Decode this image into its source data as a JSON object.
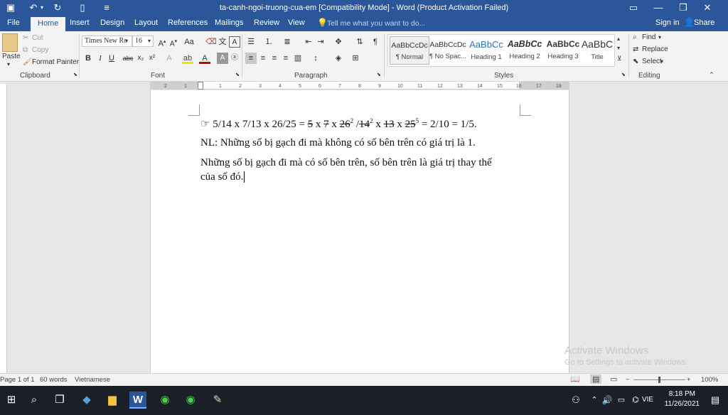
{
  "window": {
    "title": "ta-canh-ngoi-truong-cua-em [Compatibility Mode] - Word (Product Activation Failed)",
    "sign_in": "Sign in",
    "share": "Share"
  },
  "tabs": [
    "File",
    "Home",
    "Insert",
    "Design",
    "Layout",
    "References",
    "Mailings",
    "Review",
    "View"
  ],
  "tell_me": "Tell me what you want to do...",
  "clipboard": {
    "paste": "Paste",
    "cut": "Cut",
    "copy": "Copy",
    "format_painter": "Format Painter",
    "label": "Clipboard"
  },
  "font": {
    "name": "Times New Ro",
    "size": "16",
    "label": "Font"
  },
  "paragraph": {
    "label": "Paragraph"
  },
  "styles": {
    "label": "Styles",
    "items": [
      {
        "preview": "AaBbCcDc",
        "name": "¶ Normal"
      },
      {
        "preview": "AaBbCcDc",
        "name": "¶ No Spac..."
      },
      {
        "preview": "AaBbCc",
        "name": "Heading 1"
      },
      {
        "preview": "AaBbCc",
        "name": "Heading 2"
      },
      {
        "preview": "AaBbCc",
        "name": "Heading 3"
      },
      {
        "preview": "AaBbC",
        "name": "Title"
      }
    ]
  },
  "editing": {
    "find": "Find",
    "replace": "Replace",
    "select": "Select",
    "label": "Editing"
  },
  "ruler_ticks": [
    "2",
    "1",
    "1",
    "2",
    "3",
    "4",
    "5",
    "6",
    "7",
    "8",
    "9",
    "10",
    "11",
    "12",
    "13",
    "14",
    "15",
    "16",
    "17",
    "18"
  ],
  "document": {
    "line1": {
      "prefix": "☞ 5/14 x 7/13 x 26/25 = ",
      "s1": "5",
      "t1": " x ",
      "s2": "7",
      "t2": " x ",
      "s3": "26",
      "sup1": "2",
      "t3": " /",
      "s4": "14",
      "sup2": "2",
      "t4": " x ",
      "s5": "13",
      "t5": " x ",
      "s6": "25",
      "sup3": "5",
      "suffix": " = 2/10 = 1/5."
    },
    "line2": "NL: Những số bị gạch đi mà không có số bên trên có giá trị là 1.",
    "line3": "Những số bị gạch đi mà có số bên trên, số bên trên là giá trị thay thế",
    "line4": "của số đó."
  },
  "watermark": {
    "line1": "Activate Windows",
    "line2": "Go to Settings to activate Windows."
  },
  "status": {
    "page": "Page 1 of 1",
    "words": "60 words",
    "language": "Vietnamese",
    "zoom": "100%"
  },
  "taskbar": {
    "language": "VIE",
    "time": "8:18 PM",
    "date": "11/26/2021"
  }
}
